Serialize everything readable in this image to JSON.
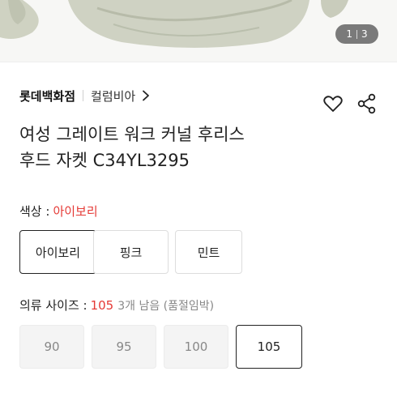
{
  "hero": {
    "image_counter": {
      "current": "1",
      "total": "3"
    }
  },
  "product": {
    "store": "롯데백화점",
    "brand": "컬럼비아",
    "title_line1": "여성 그레이트 워크 커널 후리스",
    "title_line2": "후드 자켓 C34YL3295"
  },
  "color": {
    "label": "색상 :",
    "selected_value": "아이보리",
    "options": [
      "아이보리",
      "핑크",
      "민트"
    ]
  },
  "size": {
    "label": "의류 사이즈 :",
    "selected_value": "105",
    "stock_note": "3개 남음 (품절임박)",
    "options": [
      "90",
      "95",
      "100",
      "105"
    ]
  },
  "icons": [
    "chevron-right-icon",
    "heart-icon",
    "share-icon"
  ],
  "colors": {
    "accent_red": "#e53935",
    "selected_border": "#222222"
  }
}
